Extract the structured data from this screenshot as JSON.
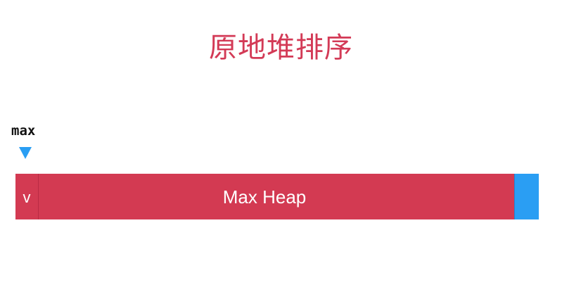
{
  "title": "原地堆排序",
  "pointer": {
    "label": "max",
    "color": "#2a9ef3"
  },
  "array": {
    "first_cell_label": "v",
    "heap_label": "Max Heap",
    "heap_color": "#d33a52",
    "sorted_color": "#2a9ef3"
  }
}
